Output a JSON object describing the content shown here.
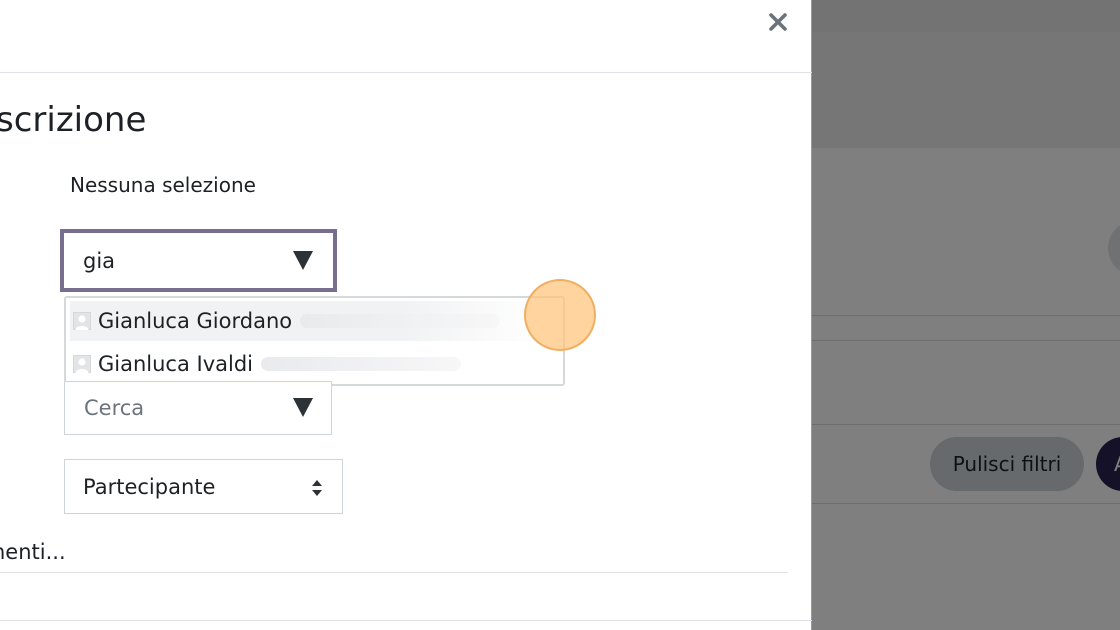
{
  "modal": {
    "title": "scrizione",
    "selection_label": "Nessuna selezione",
    "user_search": {
      "value": "gia",
      "suggestions": [
        {
          "name": "Gianluca Giordano"
        },
        {
          "name": "Gianluca Ivaldi"
        }
      ]
    },
    "cohort_search": {
      "placeholder": "Cerca"
    },
    "role_select": {
      "value": "Partecipante"
    },
    "more_link": "nenti..."
  },
  "background": {
    "clear_filters_label": "Pulisci filtri",
    "apply_label": "A"
  },
  "icons": {
    "close": "close-icon",
    "dropdown": "triangle-down-icon",
    "user": "user-avatar-icon",
    "sort": "sort-arrows-icon"
  },
  "colors": {
    "focus_border": "#786f8f",
    "primary": "#2b2350",
    "secondary_button": "#ced4da",
    "click_indicator": "#ffc478"
  }
}
